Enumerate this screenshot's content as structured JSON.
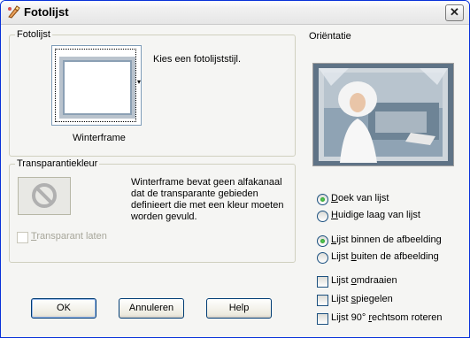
{
  "window": {
    "title": "Fotolijst",
    "close_glyph": "✕"
  },
  "fotolijst_group": {
    "label": "Fotolijst",
    "instruction": "Kies een fotolijststijl.",
    "frame_name": "Winterframe"
  },
  "transparency_group": {
    "label": "Transparantiekleur",
    "description_lines": [
      "Winterframe bevat geen alfakanaal",
      "dat de transparante gebieden",
      "definieert die met een kleur moeten",
      "worden gevuld."
    ],
    "transparent_checkbox": {
      "pre": "",
      "accel": "T",
      "post": "ransparant laten",
      "checked": false,
      "enabled": false
    }
  },
  "orientation": {
    "label": "Oriëntatie",
    "canvas_radios": [
      {
        "pre": "",
        "accel": "D",
        "post": "oek van lijst",
        "checked": true
      },
      {
        "pre": "",
        "accel": "H",
        "post": "uidige laag van lijst",
        "checked": false
      }
    ],
    "placement_radios": [
      {
        "pre": "",
        "accel": "L",
        "post": "ijst binnen de afbeelding",
        "checked": true
      },
      {
        "pre": "Lijst ",
        "accel": "b",
        "post": "uiten de afbeelding",
        "checked": false
      }
    ],
    "checkboxes": [
      {
        "pre": "Lijst ",
        "accel": "o",
        "post": "mdraaien",
        "checked": false
      },
      {
        "pre": "Lijst ",
        "accel": "s",
        "post": "piegelen",
        "checked": false
      },
      {
        "pre": "Lijst 90° ",
        "accel": "r",
        "post": "echtsom roteren",
        "checked": false
      }
    ]
  },
  "buttons": {
    "ok": "OK",
    "cancel": "Annuleren",
    "help": "Help"
  },
  "colors": {
    "titlebar_border": "#0831d9",
    "accent_blue": "#1c5180",
    "radio_green": "#21a121"
  }
}
